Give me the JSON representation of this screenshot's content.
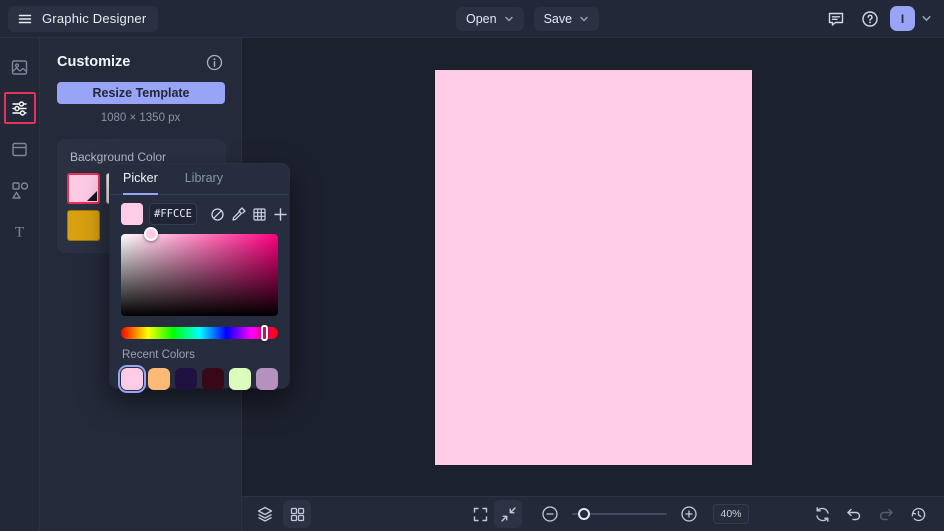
{
  "theme": {
    "accent": "#98A4F5",
    "highlight": "#E8305A",
    "topbar_bg": "#222838",
    "panel_bg": "#242A3A",
    "workspace_bg": "#1C212E"
  },
  "topbar": {
    "app_title": "Graphic Designer",
    "open_label": "Open",
    "save_label": "Save",
    "avatar_initial": "I",
    "icons": [
      "menu-icon",
      "comment-icon",
      "help-icon",
      "chevron-down-icon"
    ]
  },
  "sidebar": {
    "items": [
      {
        "id": "photos",
        "icon": "image-icon",
        "active": false
      },
      {
        "id": "customize",
        "icon": "sliders-icon",
        "active": true
      },
      {
        "id": "layouts",
        "icon": "layout-icon",
        "active": false
      },
      {
        "id": "elements",
        "icon": "shapes-icon",
        "active": false
      },
      {
        "id": "text",
        "icon": "text-icon",
        "active": false
      }
    ]
  },
  "panel": {
    "title": "Customize",
    "resize_button": "Resize Template",
    "template_size": "1080 × 1350 px",
    "background_color": {
      "label": "Background Color",
      "swatches": [
        "#FFCCE5",
        "#F6F2E9",
        "#C9134A",
        "#D9A00F"
      ],
      "selected": "#FFCCE5"
    }
  },
  "color_picker": {
    "tabs": {
      "picker": "Picker",
      "library": "Library"
    },
    "active_tab": "Picker",
    "hex_value": "#FFCCE5",
    "current_color": "#FFCCE5",
    "hue_color": "#FF0080",
    "toolbar_icons": [
      "no-color-icon",
      "eyedropper-icon",
      "palette-grid-icon",
      "plus-icon"
    ],
    "recent_label": "Recent Colors",
    "recent_colors": [
      "#FFCCE5",
      "#FCBA74",
      "#1F1240",
      "#370818",
      "#DCFCBD",
      "#B492BD"
    ],
    "selected_recent": "#FFCCE5"
  },
  "canvas": {
    "background": "#FFCCE5"
  },
  "bottombar": {
    "zoom_value": "40%",
    "icons": [
      "layers-icon",
      "pages-grid-icon",
      "fullscreen-icon",
      "fit-screen-icon",
      "zoom-out-icon",
      "zoom-in-icon",
      "refresh-icon",
      "undo-icon",
      "redo-icon",
      "history-icon"
    ]
  }
}
